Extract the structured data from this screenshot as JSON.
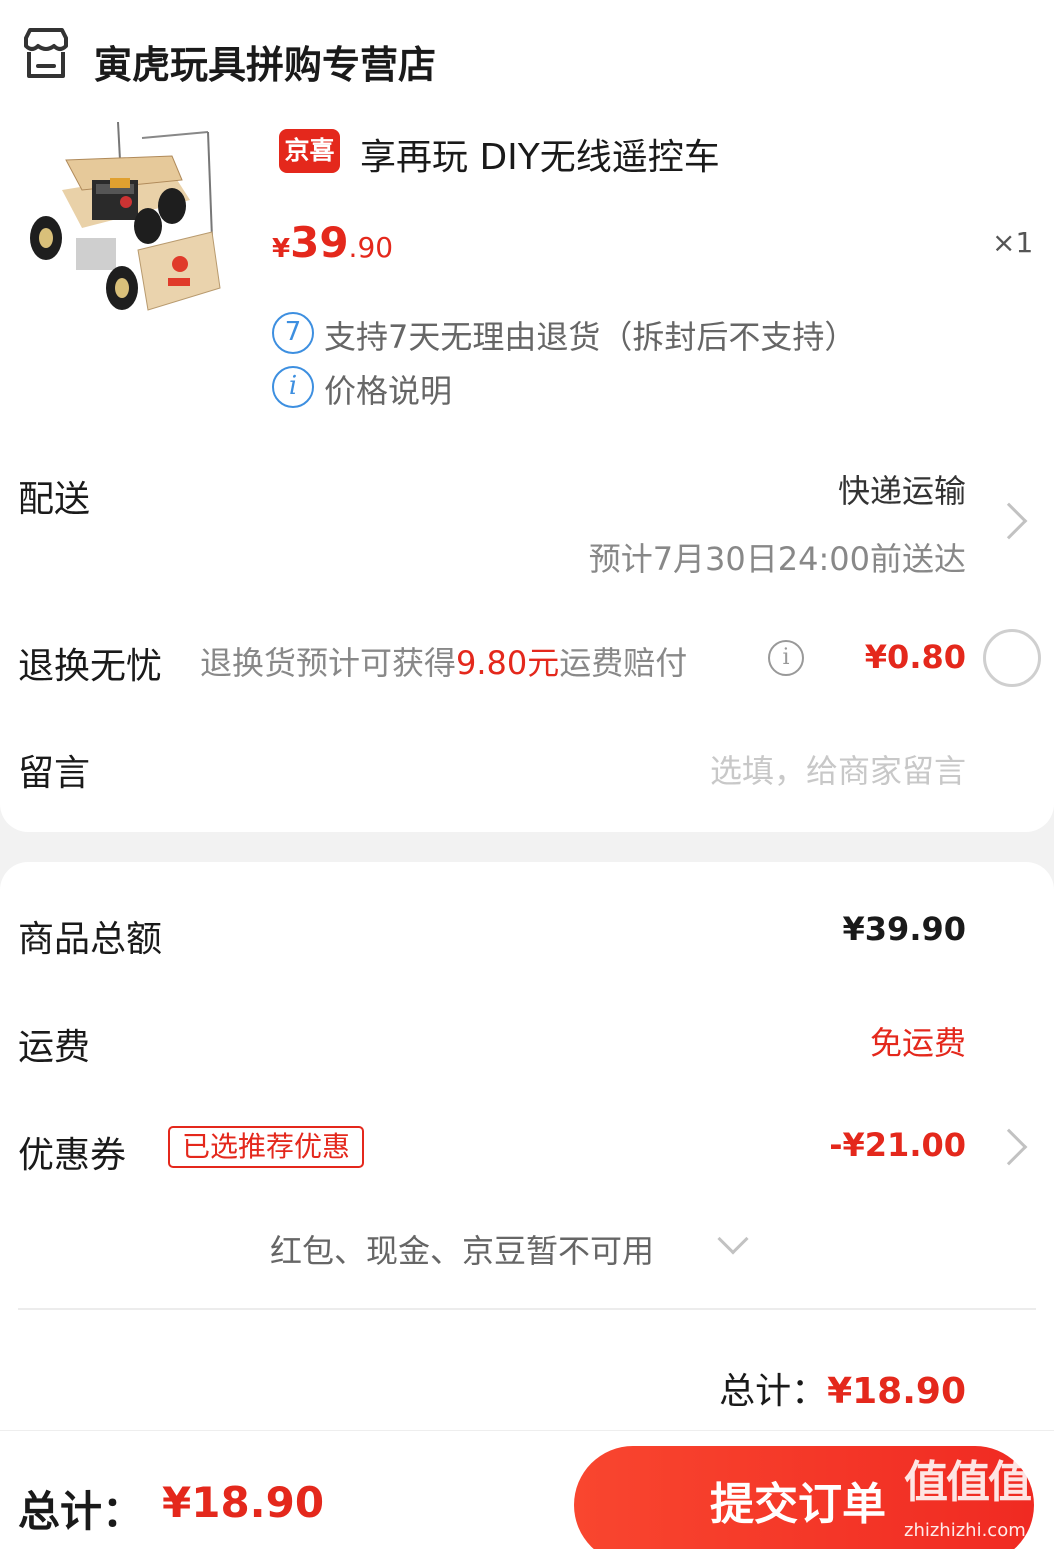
{
  "shop": {
    "icon": "store-icon",
    "name": "寅虎玩具拼购专营店"
  },
  "product": {
    "image_icon": "product-car-image",
    "badge": "京喜",
    "title": "享再玩 DIY无线遥控车",
    "price_symbol": "¥",
    "price_int": "39",
    "price_dec": ".90",
    "quantity": "×1",
    "return_policy_icon": "7",
    "return_policy": "支持7天无理由退货（拆封后不支持）",
    "price_info_icon": "i",
    "price_info": "价格说明"
  },
  "delivery": {
    "label": "配送",
    "method": "快递运输",
    "eta": "预计7月30日24:00前送达"
  },
  "return_insurance": {
    "label": "退换无忧",
    "desc_prefix": "退换货预计可获得",
    "desc_amount": "9.80元",
    "desc_suffix": "运费赔付",
    "info_icon": "i",
    "price": "¥0.80"
  },
  "message": {
    "label": "留言",
    "placeholder": "选填，给商家留言"
  },
  "summary": {
    "goods_label": "商品总额",
    "goods_value": "¥39.90",
    "shipping_label": "运费",
    "shipping_value": "免运费",
    "coupon_label": "优惠券",
    "coupon_tag": "已选推荐优惠",
    "coupon_value": "-¥21.00",
    "unavailable": "红包、现金、京豆暂不可用",
    "total_label": "总计：",
    "total_value": "¥18.90"
  },
  "bottom_bar": {
    "total_label": "总计：",
    "total_value": "¥18.90",
    "submit_label": "提交订单"
  },
  "watermark": {
    "main": "值值值",
    "sub": "zhizhizhi.com"
  },
  "colors": {
    "accent": "#e4281c",
    "link_blue": "#3d8fe0"
  }
}
